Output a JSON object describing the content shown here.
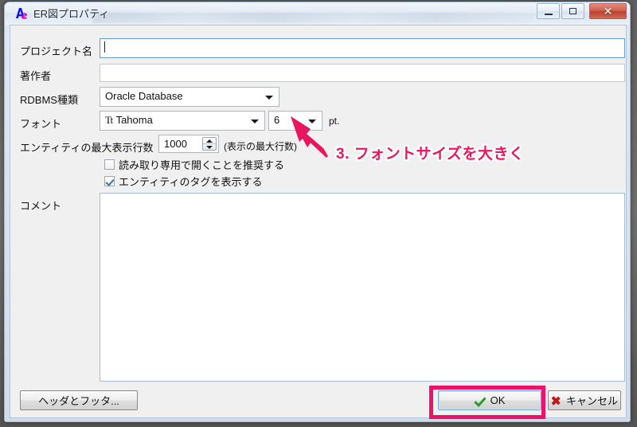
{
  "window": {
    "title": "ER図プロパティ",
    "app_icon": "as-logo-icon",
    "controls": {
      "minimize": "minimize-icon",
      "maximize": "maximize-icon",
      "close": "✕"
    }
  },
  "form": {
    "project_name": {
      "label": "プロジェクト名",
      "value": "",
      "focused": true
    },
    "author": {
      "label": "著作者",
      "value": ""
    },
    "rdbms": {
      "label": "RDBMS種類",
      "value": "Oracle Database"
    },
    "font": {
      "label": "フォント",
      "family_value": "Tahoma",
      "family_glyph": "Tt",
      "size_value": "6",
      "unit": "pt."
    },
    "max_rows": {
      "label": "エンティティの最大表示行数",
      "value": "1000",
      "hint": "(表示の最大行数)"
    },
    "readonly_checkbox": {
      "label": "読み取り専用で開くことを推奨する",
      "checked": false
    },
    "showtags_checkbox": {
      "label": "エンティティのタグを表示する",
      "checked": true
    },
    "comment": {
      "label": "コメント",
      "value": ""
    }
  },
  "footer": {
    "header_footer_button": "ヘッダとフッタ...",
    "ok_button": "OK",
    "cancel_button": "キャンセル"
  },
  "annotation": {
    "text": "3. フォントサイズを大きく",
    "color": "#ea1763",
    "highlight_color": "#ec1169"
  }
}
